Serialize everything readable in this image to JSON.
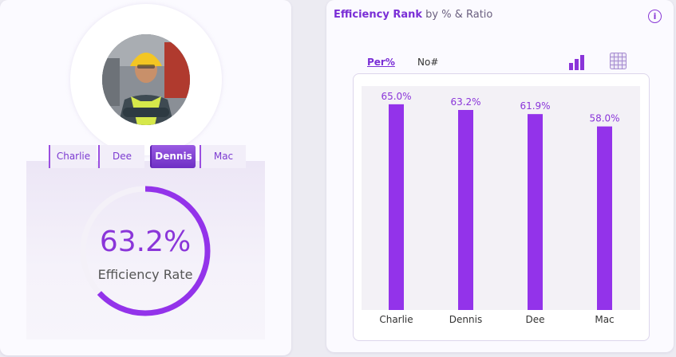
{
  "left_panel": {
    "tabs": [
      {
        "label": "Charlie",
        "active": false
      },
      {
        "label": "Dee",
        "active": false
      },
      {
        "label": "Dennis",
        "active": true
      },
      {
        "label": "Mac",
        "active": false
      }
    ],
    "gauge": {
      "value_text": "63.2%",
      "fraction": 0.632,
      "label": "Efficiency Rate"
    }
  },
  "right_panel": {
    "title_bold": "Efficiency Rank",
    "title_rest": " by % & Ratio",
    "info_icon": "info-icon",
    "segments": [
      {
        "label": "Per%",
        "active": true
      },
      {
        "label": "No#",
        "active": false
      }
    ],
    "view_icons": [
      "bar-chart-icon",
      "grid-icon"
    ]
  },
  "colors": {
    "accent": "#9333ea",
    "accent_dark": "#6e2fc4",
    "track": "#f4f1f8"
  },
  "chart_data": {
    "type": "bar",
    "categories": [
      "Charlie",
      "Dennis",
      "Dee",
      "Mac"
    ],
    "values": [
      65.0,
      63.2,
      61.9,
      58.0
    ],
    "value_labels": [
      "65.0%",
      "63.2%",
      "61.9%",
      "58.0%"
    ],
    "ylim": [
      0,
      70
    ],
    "grid": false
  }
}
